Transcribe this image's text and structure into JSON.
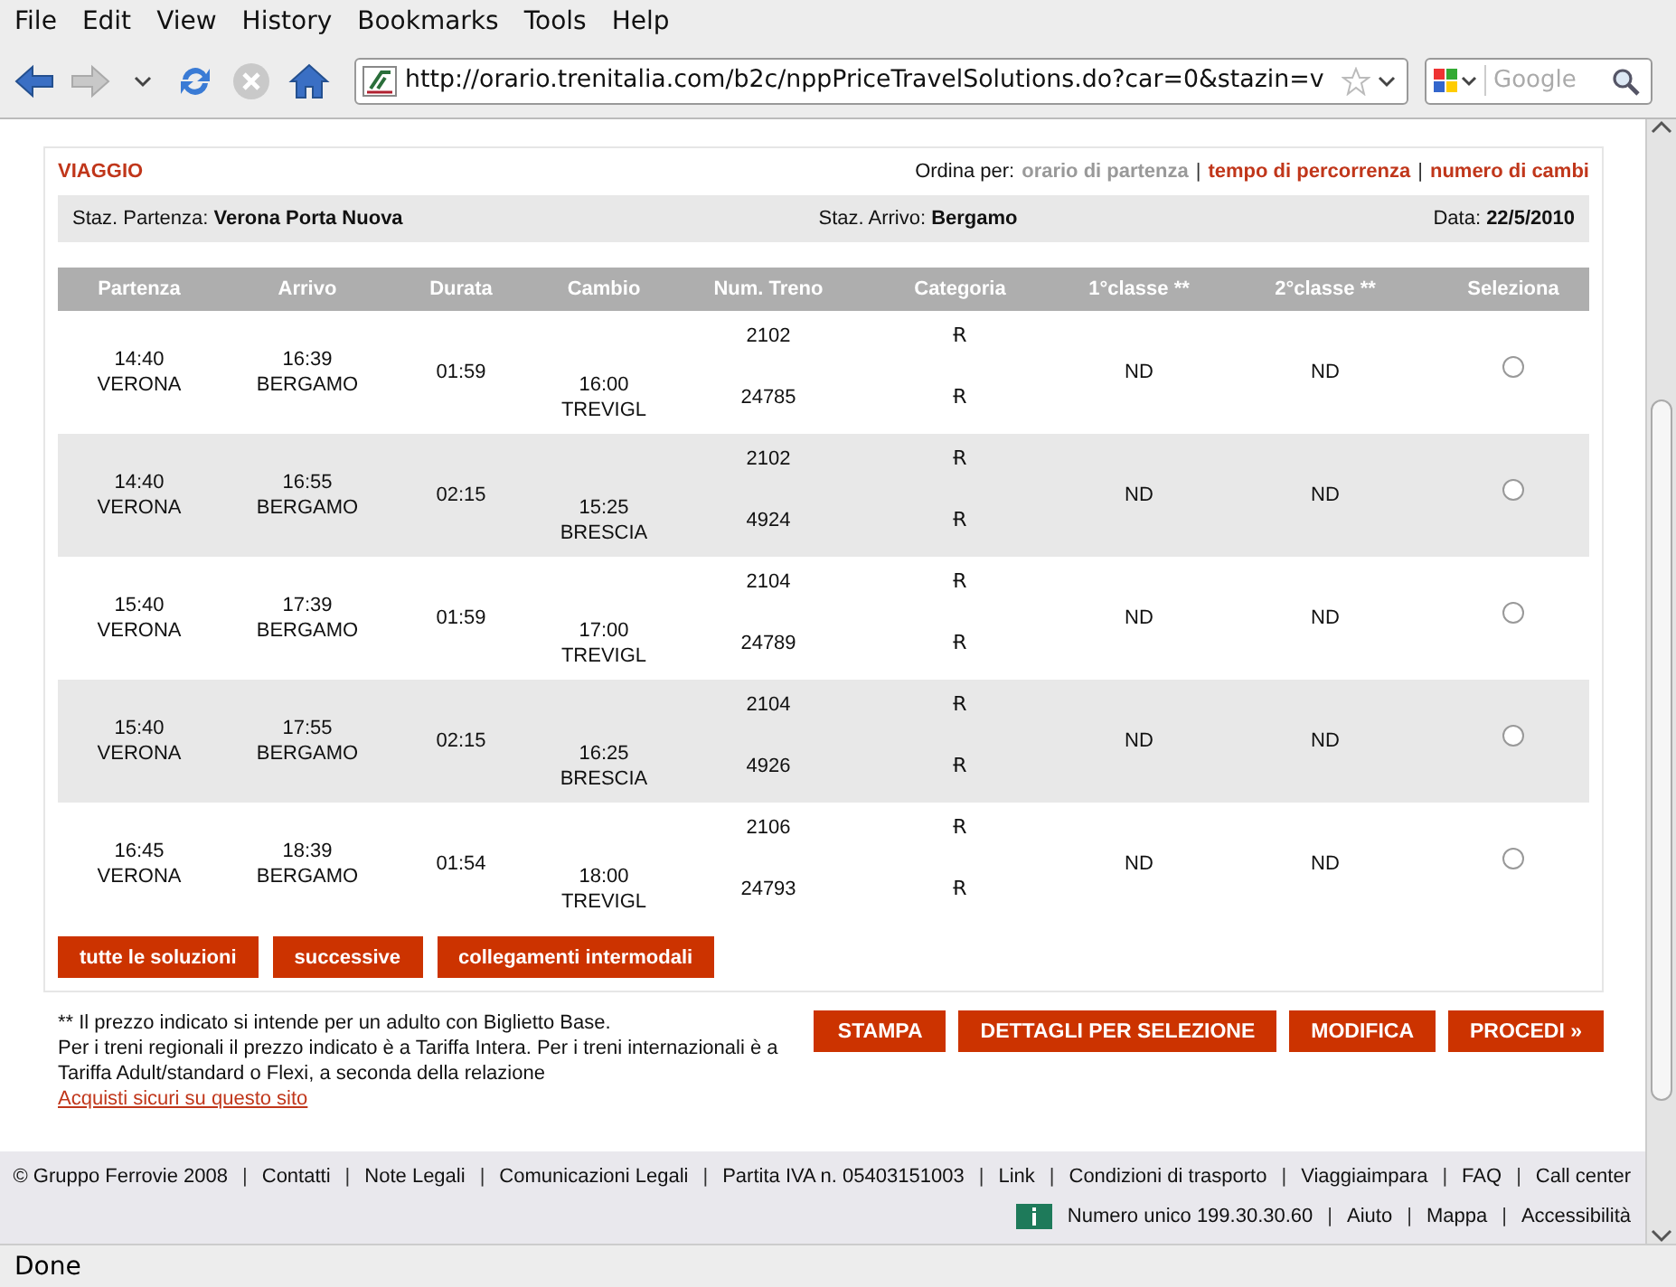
{
  "menu": [
    "File",
    "Edit",
    "View",
    "History",
    "Bookmarks",
    "Tools",
    "Help"
  ],
  "address": {
    "value": "http://orario.trenitalia.com/b2c/nppPriceTravelSolutions.do?car=0&stazin=v"
  },
  "search": {
    "placeholder": "Google"
  },
  "section_title": "VIAGGIO",
  "sort": {
    "label": "Ordina per:",
    "separator": "|",
    "options": [
      {
        "label": "orario di partenza",
        "selected": true
      },
      {
        "label": "tempo di percorrenza",
        "selected": false
      },
      {
        "label": "numero di cambi",
        "selected": false
      }
    ]
  },
  "info": {
    "departure_label": "Staz. Partenza:",
    "departure": "Verona Porta Nuova",
    "arrival_label": "Staz. Arrivo:",
    "arrival": "Bergamo",
    "date_label": "Data:",
    "date": "22/5/2010"
  },
  "table": {
    "columns": [
      "Partenza",
      "Arrivo",
      "Durata",
      "Cambio",
      "Num. Treno",
      "Categoria",
      "1°classe **",
      "2°classe **",
      "Seleziona"
    ],
    "rows": [
      {
        "dep_time": "14:40",
        "dep_station": "VERONA",
        "arr_time": "16:39",
        "arr_station": "BERGAMO",
        "duration": "01:59",
        "change_time": "16:00",
        "change_station": "TREVIGL",
        "trains": [
          "2102",
          "24785"
        ],
        "categories": [
          "Ɍ",
          "Ɍ"
        ],
        "first": "ND",
        "second": "ND",
        "selected": false
      },
      {
        "dep_time": "14:40",
        "dep_station": "VERONA",
        "arr_time": "16:55",
        "arr_station": "BERGAMO",
        "duration": "02:15",
        "change_time": "15:25",
        "change_station": "BRESCIA",
        "trains": [
          "2102",
          "4924"
        ],
        "categories": [
          "Ɍ",
          "Ɍ"
        ],
        "first": "ND",
        "second": "ND",
        "selected": false
      },
      {
        "dep_time": "15:40",
        "dep_station": "VERONA",
        "arr_time": "17:39",
        "arr_station": "BERGAMO",
        "duration": "01:59",
        "change_time": "17:00",
        "change_station": "TREVIGL",
        "trains": [
          "2104",
          "24789"
        ],
        "categories": [
          "Ɍ",
          "Ɍ"
        ],
        "first": "ND",
        "second": "ND",
        "selected": false
      },
      {
        "dep_time": "15:40",
        "dep_station": "VERONA",
        "arr_time": "17:55",
        "arr_station": "BERGAMO",
        "duration": "02:15",
        "change_time": "16:25",
        "change_station": "BRESCIA",
        "trains": [
          "2104",
          "4926"
        ],
        "categories": [
          "Ɍ",
          "Ɍ"
        ],
        "first": "ND",
        "second": "ND",
        "selected": false
      },
      {
        "dep_time": "16:45",
        "dep_station": "VERONA",
        "arr_time": "18:39",
        "arr_station": "BERGAMO",
        "duration": "01:54",
        "change_time": "18:00",
        "change_station": "TREVIGL",
        "trains": [
          "2106",
          "24793"
        ],
        "categories": [
          "Ɍ",
          "Ɍ"
        ],
        "first": "ND",
        "second": "ND",
        "selected": false
      }
    ]
  },
  "table_buttons": [
    "tutte le soluzioni",
    "successive",
    "collegamenti intermodali"
  ],
  "notes": [
    "** Il prezzo indicato si intende per un adulto con Biglietto Base.",
    "Per i treni regionali il prezzo indicato è a Tariffa Intera. Per i treni internazionali è a Tariffa Adult/standard o Flexi, a seconda della relazione"
  ],
  "secure_link": "Acquisti sicuri su questo sito",
  "action_buttons": [
    "STAMPA",
    "DETTAGLI PER SELEZIONE",
    "MODIFICA",
    "PROCEDI »"
  ],
  "footer_links": [
    "© Gruppo Ferrovie 2008",
    "Contatti",
    "Note Legali",
    "Comunicazioni Legali",
    "Partita IVA n. 05403151003",
    "Link",
    "Condizioni di trasporto",
    "Viaggiaimpara",
    "FAQ",
    "Call center"
  ],
  "footer_separator": "|",
  "footer_links_2": [
    "Numero unico 199.30.30.60",
    "Aiuto",
    "Mappa",
    "Accessibilità"
  ],
  "status": "Done"
}
